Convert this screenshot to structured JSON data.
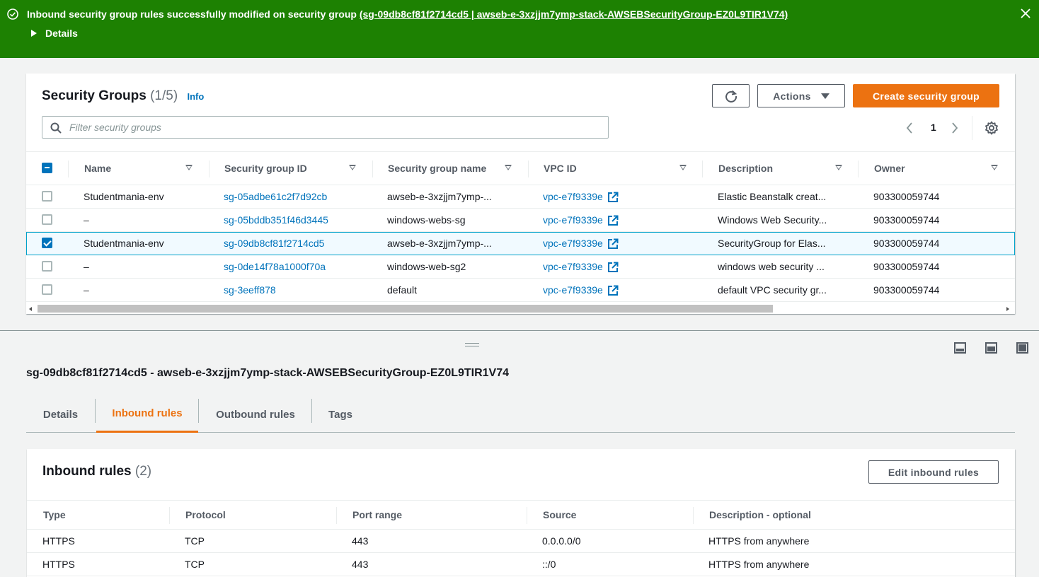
{
  "flash": {
    "message": "Inbound security group rules successfully modified on security group ",
    "link": "(sg-09db8cf81f2714cd5 | awseb-e-3xzjjm7ymp-stack-AWSEBSecurityGroup-EZ0L9TIR1V74)",
    "details_label": "Details",
    "color": "#1d8102"
  },
  "security_groups": {
    "title": "Security Groups",
    "count": "(1/5)",
    "info": "Info",
    "refresh_icon": "refresh-icon",
    "actions_label": "Actions",
    "create_label": "Create security group",
    "search_placeholder": "Filter security groups",
    "page": "1",
    "columns": [
      "Name",
      "Security group ID",
      "Security group name",
      "VPC ID",
      "Description",
      "Owner"
    ],
    "rows": [
      {
        "checked": false,
        "name": "Studentmania-env",
        "id": "sg-05adbe61c2f7d92cb",
        "sg_name": "awseb-e-3xzjjm7ymp-...",
        "vpc": "vpc-e7f9339e",
        "desc": "Elastic Beanstalk creat...",
        "owner": "903300059744"
      },
      {
        "checked": false,
        "name": "–",
        "id": "sg-05bddb351f46d3445",
        "sg_name": "windows-webs-sg",
        "vpc": "vpc-e7f9339e",
        "desc": "Windows Web Security...",
        "owner": "903300059744"
      },
      {
        "checked": true,
        "name": "Studentmania-env",
        "id": "sg-09db8cf81f2714cd5",
        "sg_name": "awseb-e-3xzjjm7ymp-...",
        "vpc": "vpc-e7f9339e",
        "desc": "SecurityGroup for Elas...",
        "owner": "903300059744"
      },
      {
        "checked": false,
        "name": "–",
        "id": "sg-0de14f78a1000f70a",
        "sg_name": "windows-web-sg2",
        "vpc": "vpc-e7f9339e",
        "desc": "windows web security ...",
        "owner": "903300059744"
      },
      {
        "checked": false,
        "name": "–",
        "id": "sg-3eeff878",
        "sg_name": "default",
        "vpc": "vpc-e7f9339e",
        "desc": "default VPC security gr...",
        "owner": "903300059744"
      }
    ]
  },
  "detail": {
    "title": "sg-09db8cf81f2714cd5 - awseb-e-3xzjjm7ymp-stack-AWSEBSecurityGroup-EZ0L9TIR1V74",
    "tabs": [
      "Details",
      "Inbound rules",
      "Outbound rules",
      "Tags"
    ],
    "active_tab": "Inbound rules"
  },
  "inbound": {
    "title": "Inbound rules",
    "count": "(2)",
    "edit_label": "Edit inbound rules",
    "columns": [
      "Type",
      "Protocol",
      "Port range",
      "Source",
      "Description - optional"
    ],
    "rows": [
      [
        "HTTPS",
        "TCP",
        "443",
        "0.0.0.0/0",
        "HTTPS from anywhere"
      ],
      [
        "HTTPS",
        "TCP",
        "443",
        "::/0",
        "HTTPS from anywhere"
      ]
    ]
  },
  "colors": {
    "accent": "#ec7211",
    "link": "#0073bb",
    "success": "#1d8102"
  }
}
